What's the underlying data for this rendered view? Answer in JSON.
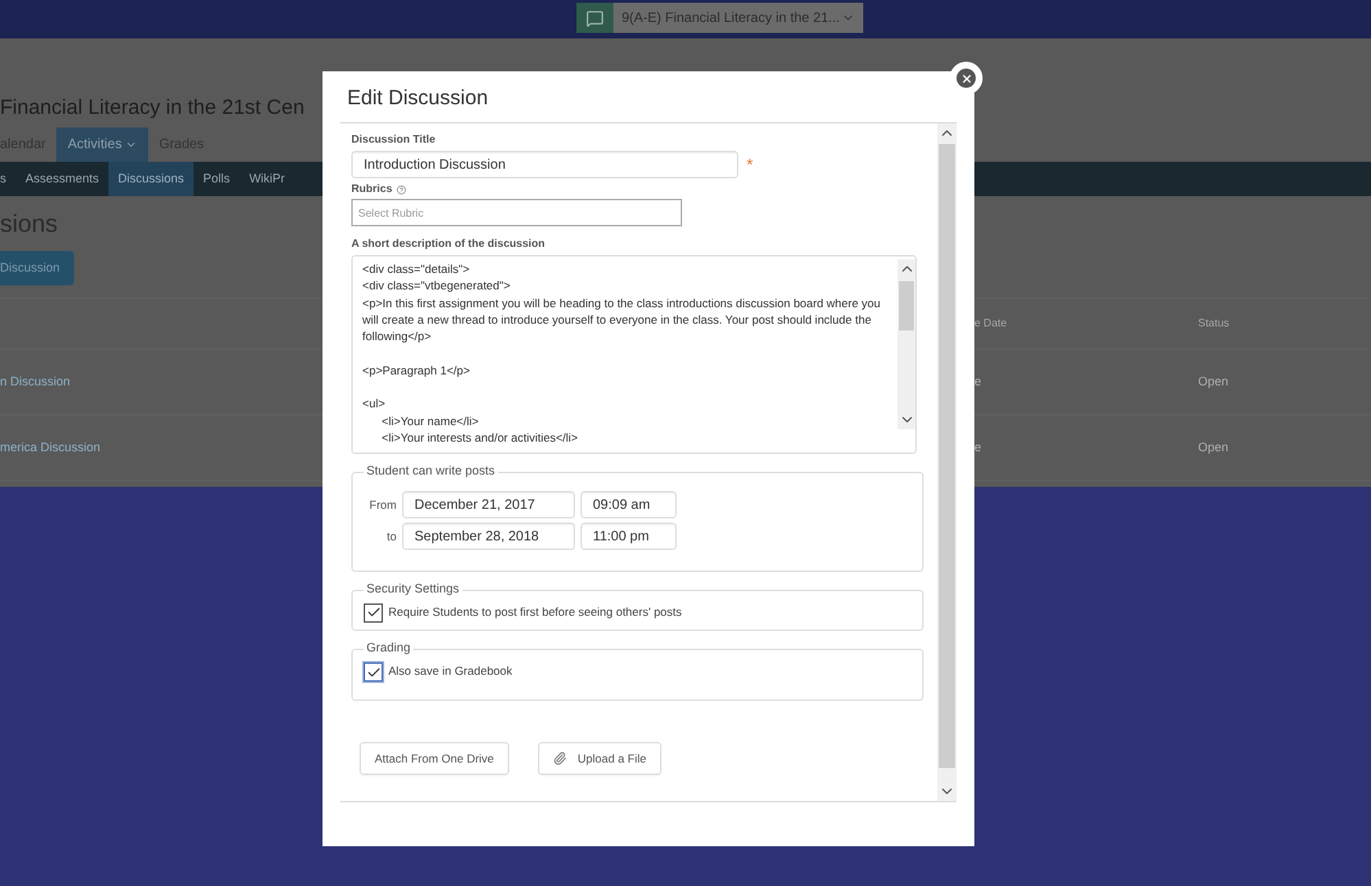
{
  "topbar": {
    "course_selector": "9(A-E) Financial Literacy in the 21..."
  },
  "page": {
    "course_title": "Financial Literacy in the 21st Cen",
    "nav": [
      {
        "label": "alendar",
        "selected": false,
        "has_menu": false
      },
      {
        "label": "Activities",
        "selected": true,
        "has_menu": true
      },
      {
        "label": "Grades",
        "selected": false,
        "has_menu": false
      }
    ],
    "subnav": [
      {
        "label": "s",
        "selected": false
      },
      {
        "label": "Assessments",
        "selected": false
      },
      {
        "label": "Discussions",
        "selected": true
      },
      {
        "label": "Polls",
        "selected": false
      },
      {
        "label": "WikiPr",
        "selected": false
      }
    ],
    "heading": "sions",
    "new_button": "Discussion",
    "table": {
      "columns": [
        "e Date",
        "Status"
      ],
      "rows": [
        {
          "title": "n Discussion",
          "date": "e",
          "status": "Open"
        },
        {
          "title": "merica Discussion",
          "date": "e",
          "status": "Open"
        }
      ]
    }
  },
  "dialog": {
    "title": "Edit Discussion",
    "title_label": "Discussion Title",
    "title_value": "Introduction Discussion",
    "required_mark": "*",
    "rubrics_label": "Rubrics",
    "rubrics_placeholder": "Select Rubric",
    "description_label": "A short description of the discussion",
    "description_value": "<div class=\"details\">\n<div class=\"vtbegenerated\">\n<p>In this first assignment you will be heading to the class introductions discussion board where you will create a new thread to introduce yourself to everyone in the class. Your post should include the following</p>\n\n<p>Paragraph 1</p>\n\n<ul>\n      <li>Your name</li>\n      <li>Your interests and/or activities</li>",
    "schedule": {
      "legend": "Student can write posts",
      "from_label": "From",
      "from_date": "December 21, 2017",
      "from_time": "09:09 am",
      "to_label": "to",
      "to_date": "September 28, 2018",
      "to_time": "11:00 pm"
    },
    "security": {
      "legend": "Security Settings",
      "label": "Require Students to post first before seeing others' posts",
      "checked": true
    },
    "grading": {
      "legend": "Grading",
      "label": "Also save in Gradebook",
      "checked": true
    },
    "buttons": [
      {
        "kind": "plain",
        "label": "Attach From One Drive"
      },
      {
        "kind": "attach",
        "label": "Upload a File"
      }
    ]
  }
}
